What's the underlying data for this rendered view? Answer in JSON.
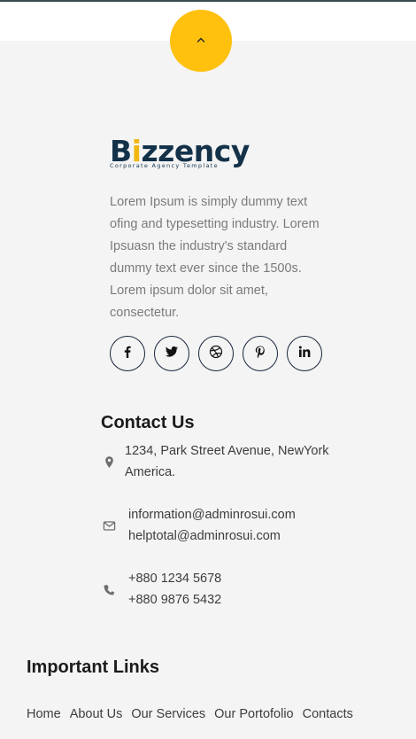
{
  "brand": {
    "name_prefix": "B",
    "name_accent": "i",
    "name_suffix": "zzency",
    "tagline": "Corporate Agency Template"
  },
  "about": {
    "text": "Lorem Ipsum is simply dummy text ofing and typesetting industry. Lorem Ipsuasn the industry's standard dummy text ever since the 1500s. Lorem ipsum dolor sit amet, consectetur."
  },
  "socials": [
    {
      "icon": "facebook-icon"
    },
    {
      "icon": "twitter-icon"
    },
    {
      "icon": "dribbble-icon"
    },
    {
      "icon": "pinterest-icon"
    },
    {
      "icon": "linkedin-icon"
    }
  ],
  "contact": {
    "title": "Contact Us",
    "address_line1": "1234, Park Street Avenue, NewYork",
    "address_line2": "America.",
    "email1": "information@adminrosui.com",
    "email2": "helptotal@adminrosui.com",
    "phone1": "+880 1234 5678",
    "phone2": "+880 9876 5432"
  },
  "links": {
    "title": "Important Links",
    "items": [
      "Home",
      "About Us",
      "Our Services",
      "Our Portofolio",
      "Contacts"
    ]
  },
  "colors": {
    "accent": "#ffc10e",
    "brand_navy": "#13324a",
    "background": "#f4f4f4"
  }
}
